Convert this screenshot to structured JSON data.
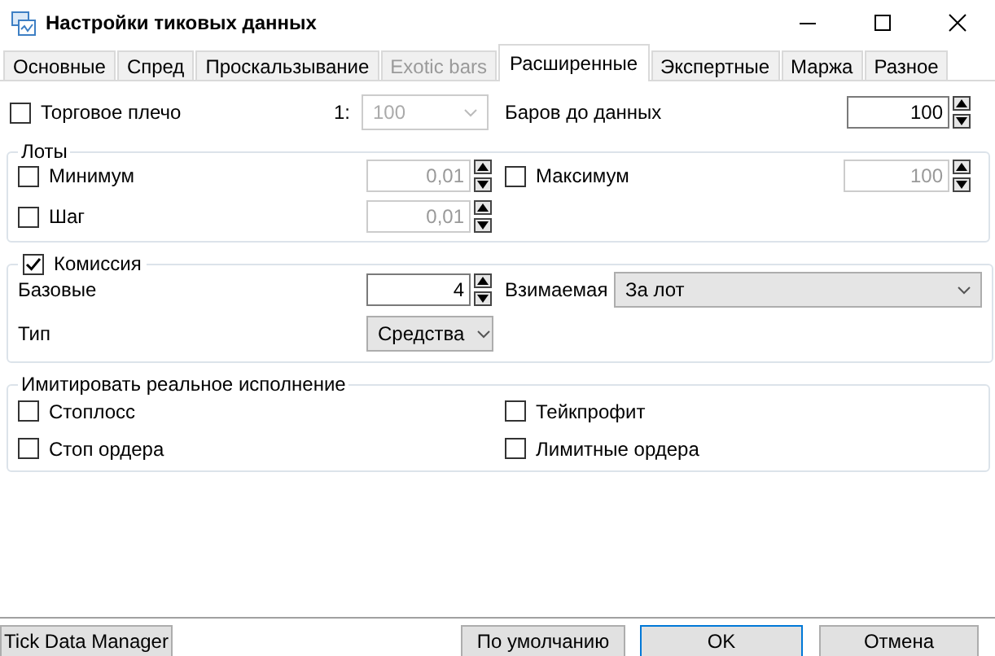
{
  "window": {
    "title": "Настройки тиковых данных"
  },
  "tabs": [
    {
      "label": "Основные",
      "selected": false,
      "disabled": false
    },
    {
      "label": "Спред",
      "selected": false,
      "disabled": false
    },
    {
      "label": "Проскальзывание",
      "selected": false,
      "disabled": false
    },
    {
      "label": "Exotic bars",
      "selected": false,
      "disabled": true
    },
    {
      "label": "Расширенные",
      "selected": true,
      "disabled": false
    },
    {
      "label": "Экспертные",
      "selected": false,
      "disabled": false
    },
    {
      "label": "Маржа",
      "selected": false,
      "disabled": false
    },
    {
      "label": "Разное",
      "selected": false,
      "disabled": false
    }
  ],
  "leverage": {
    "label": "Торговое плечо",
    "checked": false,
    "prefix": "1:",
    "value": "100",
    "disabled": true
  },
  "bars_before": {
    "label": "Баров до данных",
    "value": "100"
  },
  "lots": {
    "title": "Лоты",
    "minimum": {
      "label": "Минимум",
      "checked": false,
      "value": "0,01",
      "disabled": true
    },
    "maximum": {
      "label": "Максимум",
      "checked": false,
      "value": "100",
      "disabled": true
    },
    "step": {
      "label": "Шаг",
      "checked": false,
      "value": "0,01",
      "disabled": true
    }
  },
  "commission": {
    "label": "Комиссия",
    "checked": true,
    "base": {
      "label": "Базовые",
      "value": "4"
    },
    "charged": {
      "label": "Взимаемая",
      "value": "За лот"
    },
    "type": {
      "label": "Тип",
      "value": "Средства"
    }
  },
  "simulate": {
    "title": "Имитировать реальное исполнение",
    "options": [
      {
        "label": "Стоплосс",
        "checked": false
      },
      {
        "label": "Тейкпрофит",
        "checked": false
      },
      {
        "label": "Стоп ордера",
        "checked": false
      },
      {
        "label": "Лимитные ордера",
        "checked": false
      }
    ]
  },
  "buttons": [
    {
      "label": "Tick Data Manager",
      "default": false
    },
    {
      "label": "По умолчанию",
      "default": false
    },
    {
      "label": "OK",
      "default": true
    },
    {
      "label": "Отмена",
      "default": false
    }
  ]
}
